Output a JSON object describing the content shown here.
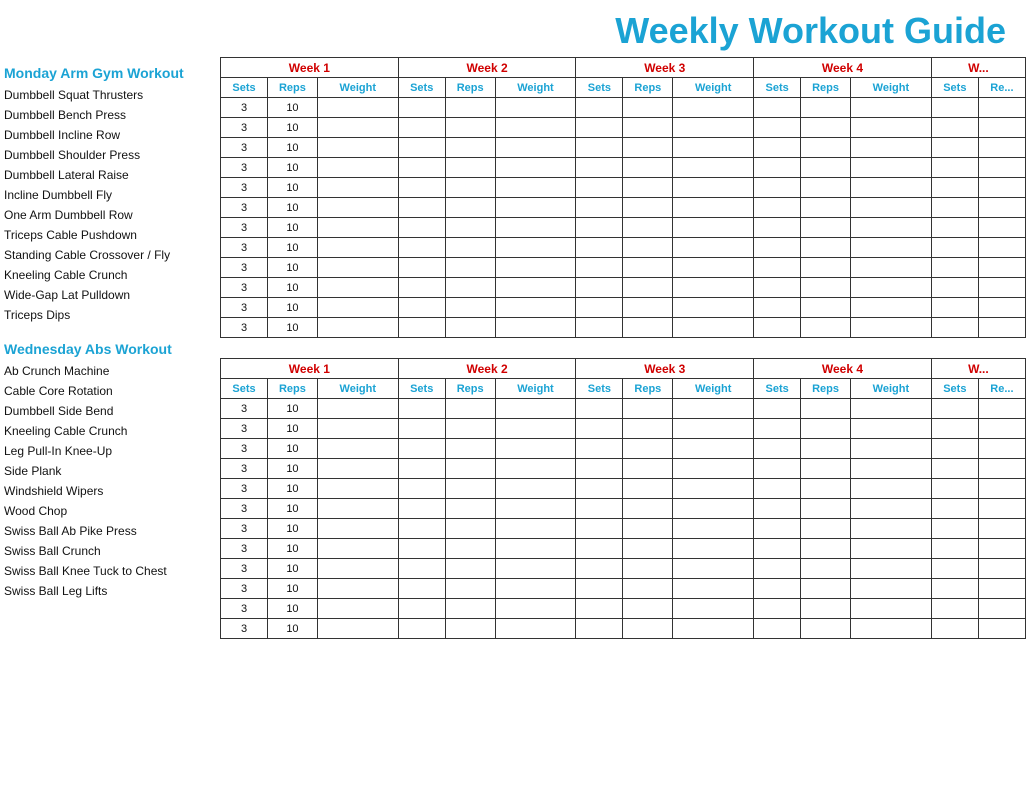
{
  "title": "Weekly Workout Guide",
  "sections": [
    {
      "id": "monday",
      "title": "Monday Arm Gym Workout",
      "exercises": [
        "Dumbbell Squat Thrusters",
        "Dumbbell Bench Press",
        "Dumbbell Incline Row",
        "Dumbbell Shoulder Press",
        "Dumbbell Lateral Raise",
        "Incline Dumbbell Fly",
        "One Arm Dumbbell Row",
        "Triceps Cable Pushdown",
        "Standing Cable Crossover / Fly",
        "Kneeling Cable Crunch",
        "Wide-Gap Lat Pulldown",
        "Triceps Dips"
      ]
    },
    {
      "id": "wednesday",
      "title": "Wednesday Abs Workout",
      "exercises": [
        "Ab Crunch Machine",
        "Cable Core Rotation",
        "Dumbbell Side Bend",
        "Kneeling Cable Crunch",
        "Leg Pull-In Knee-Up",
        "Side Plank",
        "Windshield Wipers",
        "Wood Chop",
        "Swiss Ball Ab Pike Press",
        "Swiss Ball Crunch",
        "Swiss Ball Knee Tuck to Chest",
        "Swiss Ball Leg Lifts"
      ]
    }
  ],
  "weeks": [
    "Week 1",
    "Week 2",
    "Week 3",
    "Week 4",
    "W..."
  ],
  "col_headers": [
    "Sets",
    "Reps",
    "Weight"
  ],
  "default_sets": "3",
  "default_reps": "10"
}
